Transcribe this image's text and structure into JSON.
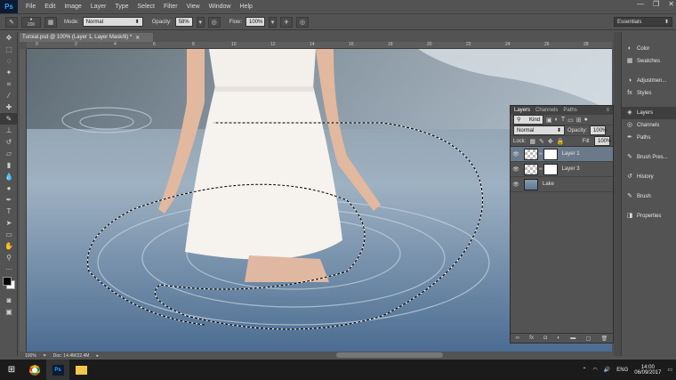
{
  "app": {
    "logo": "Ps"
  },
  "menu": [
    "File",
    "Edit",
    "Image",
    "Layer",
    "Type",
    "Select",
    "Filter",
    "View",
    "Window",
    "Help"
  ],
  "window_controls": {
    "minimize": "—",
    "restore": "❐",
    "close": "✕"
  },
  "options": {
    "brush_size": "200",
    "mode_label": "Mode:",
    "mode_value": "Normal",
    "opacity_label": "Opacity:",
    "opacity_value": "58%",
    "flow_label": "Flow:",
    "flow_value": "100%",
    "workspace": "Essentials"
  },
  "document": {
    "tab_title": "Turoial.psd @ 100% (Layer 1, Layer Mask/8) *",
    "ruler_marks": [
      "0",
      "2",
      "4",
      "6",
      "8",
      "10",
      "12",
      "14",
      "16",
      "18",
      "20",
      "22",
      "24",
      "26",
      "28"
    ],
    "zoom": "100%",
    "doc_info": "Doc: 14.4M/22.4M"
  },
  "layers_panel": {
    "tabs": [
      "Layers",
      "Channels",
      "Paths"
    ],
    "active_tab": "Layers",
    "filter_kind": "Kind",
    "blend_mode": "Normal",
    "opacity_label": "Opacity:",
    "opacity_value": "100%",
    "lock_label": "Lock:",
    "fill_label": "Fill:",
    "fill_value": "100%",
    "layers": [
      {
        "name": "Layer 1",
        "selected": true
      },
      {
        "name": "Layer 3",
        "selected": false
      },
      {
        "name": "Lake",
        "selected": false
      }
    ],
    "footer_icons": [
      "link-icon",
      "fx-icon",
      "mask-icon",
      "adjustment-icon",
      "folder-icon",
      "new-layer-icon",
      "trash-icon"
    ]
  },
  "dock": {
    "items": [
      {
        "label": "Color",
        "icon": "color-icon"
      },
      {
        "label": "Swatches",
        "icon": "swatches-icon"
      },
      {
        "label": "Adjustmen...",
        "icon": "adjustments-icon"
      },
      {
        "label": "Styles",
        "icon": "styles-icon"
      },
      {
        "label": "Layers",
        "icon": "layers-icon"
      },
      {
        "label": "Channels",
        "icon": "channels-icon"
      },
      {
        "label": "Paths",
        "icon": "paths-icon"
      },
      {
        "label": "Brush Pres...",
        "icon": "brush-presets-icon"
      },
      {
        "label": "History",
        "icon": "history-icon"
      },
      {
        "label": "Brush",
        "icon": "brush-icon"
      },
      {
        "label": "Properties",
        "icon": "properties-icon"
      }
    ]
  },
  "taskbar": {
    "language": "ENG",
    "time": "14:00",
    "date": "06/09/2017"
  },
  "colors": {
    "foreground": "#000000",
    "background": "#ffffff",
    "accent": "#2fa3f7"
  }
}
